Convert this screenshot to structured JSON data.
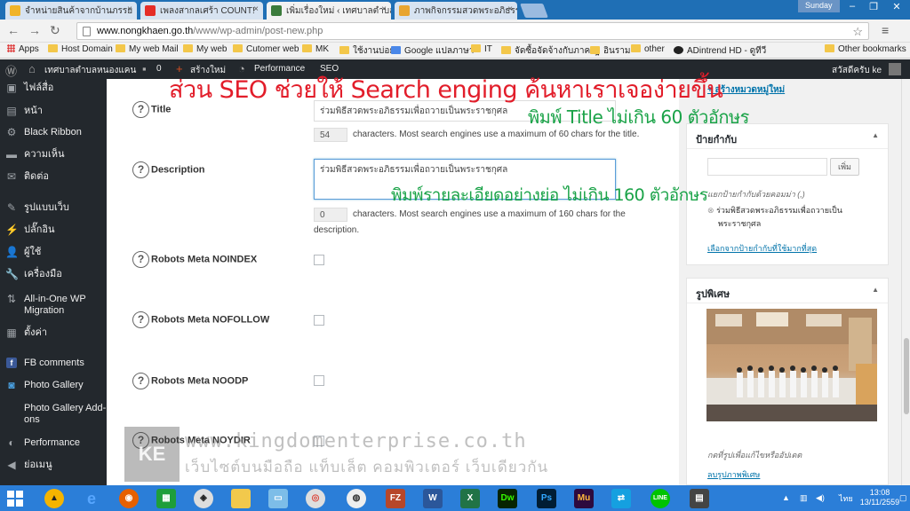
{
  "browser": {
    "tabs": [
      {
        "label": "จำหน่ายสินค้าจากบ้านภรรย",
        "color": "#f0b429"
      },
      {
        "label": "เพลงสากลเศร้า COUNT!",
        "color": "#e52d27"
      },
      {
        "label": "เพิ่มเรื่องใหม่ ‹ เทศบาลตำบลห",
        "color": "#3b7b3b"
      },
      {
        "label": "ภาพกิจกรรมสวดพระอภิธรรม",
        "color": "#e8a530"
      }
    ],
    "window_user": "Sunday",
    "url_host": "www.nongkhaen.go.th",
    "url_path": "/www/wp-admin/post-new.php",
    "bookmarks": [
      "Apps",
      "Host Domain",
      "My web Mail",
      "My web",
      "Cutomer web",
      "MK",
      "ใช้งานบ่อย",
      "Google แปลภาษา",
      "IT",
      "จัดซื้อจัดจ้างกับภาครัฐ",
      "อินราม",
      "other",
      "ADintrend HD - ดูทีวี",
      "Other bookmarks"
    ]
  },
  "adminbar": {
    "site_name": "เทศบาลตำบลหนองแคน",
    "comments": "0",
    "new_label": "สร้างใหม่",
    "performance": "Performance",
    "seo": "SEO",
    "greeting": "สวัสดีครับ ke"
  },
  "sidebar": {
    "items": [
      {
        "label": "ไฟล์สื่อ",
        "icon": "media-icon"
      },
      {
        "label": "หน้า",
        "icon": "page-icon"
      },
      {
        "label": "Black Ribbon",
        "icon": "gear-icon"
      },
      {
        "label": "ความเห็น",
        "icon": "comment-icon"
      },
      {
        "label": "ติดต่อ",
        "icon": "mail-icon"
      },
      {
        "label": "รูปแบบเว็บ",
        "icon": "brush-icon"
      },
      {
        "label": "ปลั๊กอิน",
        "icon": "plugin-icon"
      },
      {
        "label": "ผู้ใช้",
        "icon": "user-icon"
      },
      {
        "label": "เครื่องมือ",
        "icon": "wrench-icon"
      },
      {
        "label": "All-in-One WP Migration",
        "icon": "migration-icon"
      },
      {
        "label": "ตั้งค่า",
        "icon": "settings-icon"
      },
      {
        "label": "FB comments",
        "icon": "facebook-icon"
      },
      {
        "label": "Photo Gallery",
        "icon": "camera-icon"
      },
      {
        "label": "Photo Gallery Add-ons",
        "icon": "addon-icon"
      },
      {
        "label": "Performance",
        "icon": "performance-icon"
      },
      {
        "label": "ย่อเมนู",
        "icon": "collapse-icon"
      }
    ]
  },
  "seo": {
    "title_label": "Title",
    "title_value": "ร่วมพิธีสวดพระอภิธรรมเพื่อถวายเป็นพระราชกุศล",
    "title_count": "54",
    "title_hint": "characters. Most search engines use a maximum of 60 chars for the title.",
    "description_label": "Description",
    "description_value": "ร่วมพิธีสวดพระอภิธรรมเพื่อถวายเป็นพระราชกุศล",
    "description_count": "0",
    "description_hint_1": "characters. Most search engines use a maximum of 160 chars for the",
    "description_hint_2": "description.",
    "noindex_label": "Robots Meta NOINDEX",
    "nofollow_label": "Robots Meta NOFOLLOW",
    "noodp_label": "Robots Meta NOODP",
    "noydir_label": "Robots Meta NOYDIR"
  },
  "widgets": {
    "add_category": "+ สร้างหมวดหมู่ใหม่",
    "tags_title": "ป้ายกำกับ",
    "tags_add": "เพิ่ม",
    "tags_hint": "แยกป้ายกำกับด้วยคอมม่า (,)",
    "tag_item_1": "ร่วมพิธีสวดพระอภิธรรมเพื่อถวายเป็น",
    "tag_item_2": "พระราชกุศล",
    "tags_popular": "เลือกจากป้ายกำกับที่ใช้มากที่สุด",
    "featured_title": "รูปพิเศษ",
    "featured_hint": "กดที่รูปเพื่อแก้ไขหรืออัปเดต",
    "featured_remove": "ลบรูปภาพพิเศษ"
  },
  "annotations": {
    "red": "ส่วน SEO ช่วยให้ Search enging ค้นหาเราเจอง่ายขึ้น",
    "green_title": "พิมพ์ Title ไม่เกิน 60 ตัวอักษร",
    "green_desc": "พิมพ์รายละเอียดอย่างย่อ ไม่เกิน 160 ตัวอักษร"
  },
  "watermark": {
    "logo": "KE",
    "line1": "www.kingdomenterprise.co.th",
    "line2": "เว็บไซต์บนมือถือ แท็บเล็ต คอมพิวเตอร์ เว็บเดียวกัน"
  },
  "taskbar": {
    "lang": "ไทย",
    "time": "13:08",
    "date": "13/11/2559"
  },
  "colors": {
    "annotation_red": "#e21d2a",
    "annotation_green": "#1aa348",
    "taskbar": "#2b7ed8",
    "wp_dark": "#23282d",
    "link": "#0073aa"
  }
}
